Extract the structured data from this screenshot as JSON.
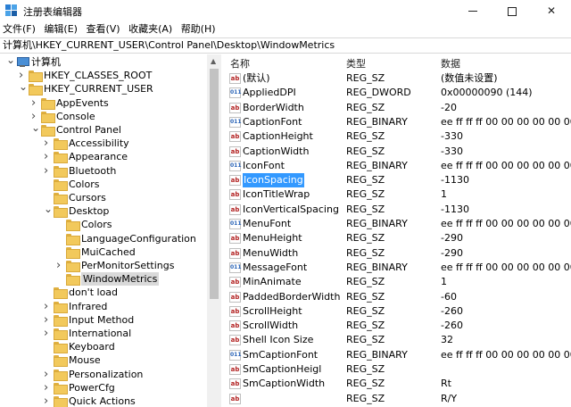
{
  "window": {
    "title": "注册表编辑器",
    "minimize_icon": "minimize-icon",
    "maximize_icon": "maximize-icon",
    "close_glyph": "✕"
  },
  "menu": [
    "文件(F)",
    "编辑(E)",
    "查看(V)",
    "收藏夹(A)",
    "帮助(H)"
  ],
  "address": "计算机\\HKEY_CURRENT_USER\\Control Panel\\Desktop\\WindowMetrics",
  "tree": [
    {
      "label": "计算机",
      "level": 0,
      "expander": "open",
      "icon": "computer-icon"
    },
    {
      "label": "HKEY_CLASSES_ROOT",
      "level": 1,
      "expander": "closed",
      "icon": "folder-icon"
    },
    {
      "label": "HKEY_CURRENT_USER",
      "level": 1,
      "expander": "open",
      "icon": "folder-icon"
    },
    {
      "label": "AppEvents",
      "level": 2,
      "expander": "closed",
      "icon": "folder-icon"
    },
    {
      "label": "Console",
      "level": 2,
      "expander": "closed",
      "icon": "folder-icon"
    },
    {
      "label": "Control Panel",
      "level": 2,
      "expander": "open",
      "icon": "folder-icon"
    },
    {
      "label": "Accessibility",
      "level": 3,
      "expander": "closed",
      "icon": "folder-icon"
    },
    {
      "label": "Appearance",
      "level": 3,
      "expander": "closed",
      "icon": "folder-icon"
    },
    {
      "label": "Bluetooth",
      "level": 3,
      "expander": "closed",
      "icon": "folder-icon"
    },
    {
      "label": "Colors",
      "level": 3,
      "expander": "none",
      "icon": "folder-icon"
    },
    {
      "label": "Cursors",
      "level": 3,
      "expander": "none",
      "icon": "folder-icon"
    },
    {
      "label": "Desktop",
      "level": 3,
      "expander": "open",
      "icon": "folder-icon"
    },
    {
      "label": "Colors",
      "level": 4,
      "expander": "none",
      "icon": "folder-icon"
    },
    {
      "label": "LanguageConfiguration",
      "level": 4,
      "expander": "none",
      "icon": "folder-icon"
    },
    {
      "label": "MuiCached",
      "level": 4,
      "expander": "none",
      "icon": "folder-icon"
    },
    {
      "label": "PerMonitorSettings",
      "level": 4,
      "expander": "closed",
      "icon": "folder-icon"
    },
    {
      "label": "WindowMetrics",
      "level": 4,
      "expander": "none",
      "icon": "folder-icon",
      "selected": true
    },
    {
      "label": "don't load",
      "level": 3,
      "expander": "none",
      "icon": "folder-icon"
    },
    {
      "label": "Infrared",
      "level": 3,
      "expander": "closed",
      "icon": "folder-icon"
    },
    {
      "label": "Input Method",
      "level": 3,
      "expander": "closed",
      "icon": "folder-icon"
    },
    {
      "label": "International",
      "level": 3,
      "expander": "closed",
      "icon": "folder-icon"
    },
    {
      "label": "Keyboard",
      "level": 3,
      "expander": "none",
      "icon": "folder-icon"
    },
    {
      "label": "Mouse",
      "level": 3,
      "expander": "none",
      "icon": "folder-icon"
    },
    {
      "label": "Personalization",
      "level": 3,
      "expander": "closed",
      "icon": "folder-icon"
    },
    {
      "label": "PowerCfg",
      "level": 3,
      "expander": "closed",
      "icon": "folder-icon"
    },
    {
      "label": "Quick Actions",
      "level": 3,
      "expander": "closed",
      "icon": "folder-icon"
    }
  ],
  "columns": {
    "name": "名称",
    "type": "类型",
    "data": "数据"
  },
  "values": [
    {
      "name": "(默认)",
      "type": "REG_SZ",
      "data": "(数值未设置)",
      "kind": "sz"
    },
    {
      "name": "AppliedDPI",
      "type": "REG_DWORD",
      "data": "0x00000090 (144)",
      "kind": "bin"
    },
    {
      "name": "BorderWidth",
      "type": "REG_SZ",
      "data": "-20",
      "kind": "sz"
    },
    {
      "name": "CaptionFont",
      "type": "REG_BINARY",
      "data": "ee ff ff ff 00 00 00 00 00 00",
      "kind": "bin"
    },
    {
      "name": "CaptionHeight",
      "type": "REG_SZ",
      "data": "-330",
      "kind": "sz"
    },
    {
      "name": "CaptionWidth",
      "type": "REG_SZ",
      "data": "-330",
      "kind": "sz"
    },
    {
      "name": "IconFont",
      "type": "REG_BINARY",
      "data": "ee ff ff ff 00 00 00 00 00 00",
      "kind": "bin"
    },
    {
      "name": "IconSpacing",
      "type": "REG_SZ",
      "data": "-1130",
      "kind": "sz",
      "selected": true
    },
    {
      "name": "IconTitleWrap",
      "type": "REG_SZ",
      "data": "1",
      "kind": "sz"
    },
    {
      "name": "IconVerticalSpacing",
      "type": "REG_SZ",
      "data": "-1130",
      "kind": "sz"
    },
    {
      "name": "MenuFont",
      "type": "REG_BINARY",
      "data": "ee ff ff ff 00 00 00 00 00 00",
      "kind": "bin"
    },
    {
      "name": "MenuHeight",
      "type": "REG_SZ",
      "data": "-290",
      "kind": "sz"
    },
    {
      "name": "MenuWidth",
      "type": "REG_SZ",
      "data": "-290",
      "kind": "sz"
    },
    {
      "name": "MessageFont",
      "type": "REG_BINARY",
      "data": "ee ff ff ff 00 00 00 00 00 00",
      "kind": "bin"
    },
    {
      "name": "MinAnimate",
      "type": "REG_SZ",
      "data": "1",
      "kind": "sz"
    },
    {
      "name": "PaddedBorderWidth",
      "type": "REG_SZ",
      "data": "-60",
      "kind": "sz"
    },
    {
      "name": "ScrollHeight",
      "type": "REG_SZ",
      "data": "-260",
      "kind": "sz"
    },
    {
      "name": "ScrollWidth",
      "type": "REG_SZ",
      "data": "-260",
      "kind": "sz"
    },
    {
      "name": "Shell Icon Size",
      "type": "REG_SZ",
      "data": "32",
      "kind": "sz"
    },
    {
      "name": "SmCaptionFont",
      "type": "REG_BINARY",
      "data": "ee ff ff ff 00 00 00 00 00 00",
      "kind": "bin"
    },
    {
      "name": "SmCaptionHeigl",
      "type": "REG_SZ",
      "data": "",
      "kind": "sz"
    },
    {
      "name": "SmCaptionWidth",
      "type": "REG_SZ",
      "data": "Rt",
      "kind": "sz"
    },
    {
      "name": "",
      "type": "REG_SZ",
      "data": "R/Y",
      "kind": "sz"
    }
  ]
}
